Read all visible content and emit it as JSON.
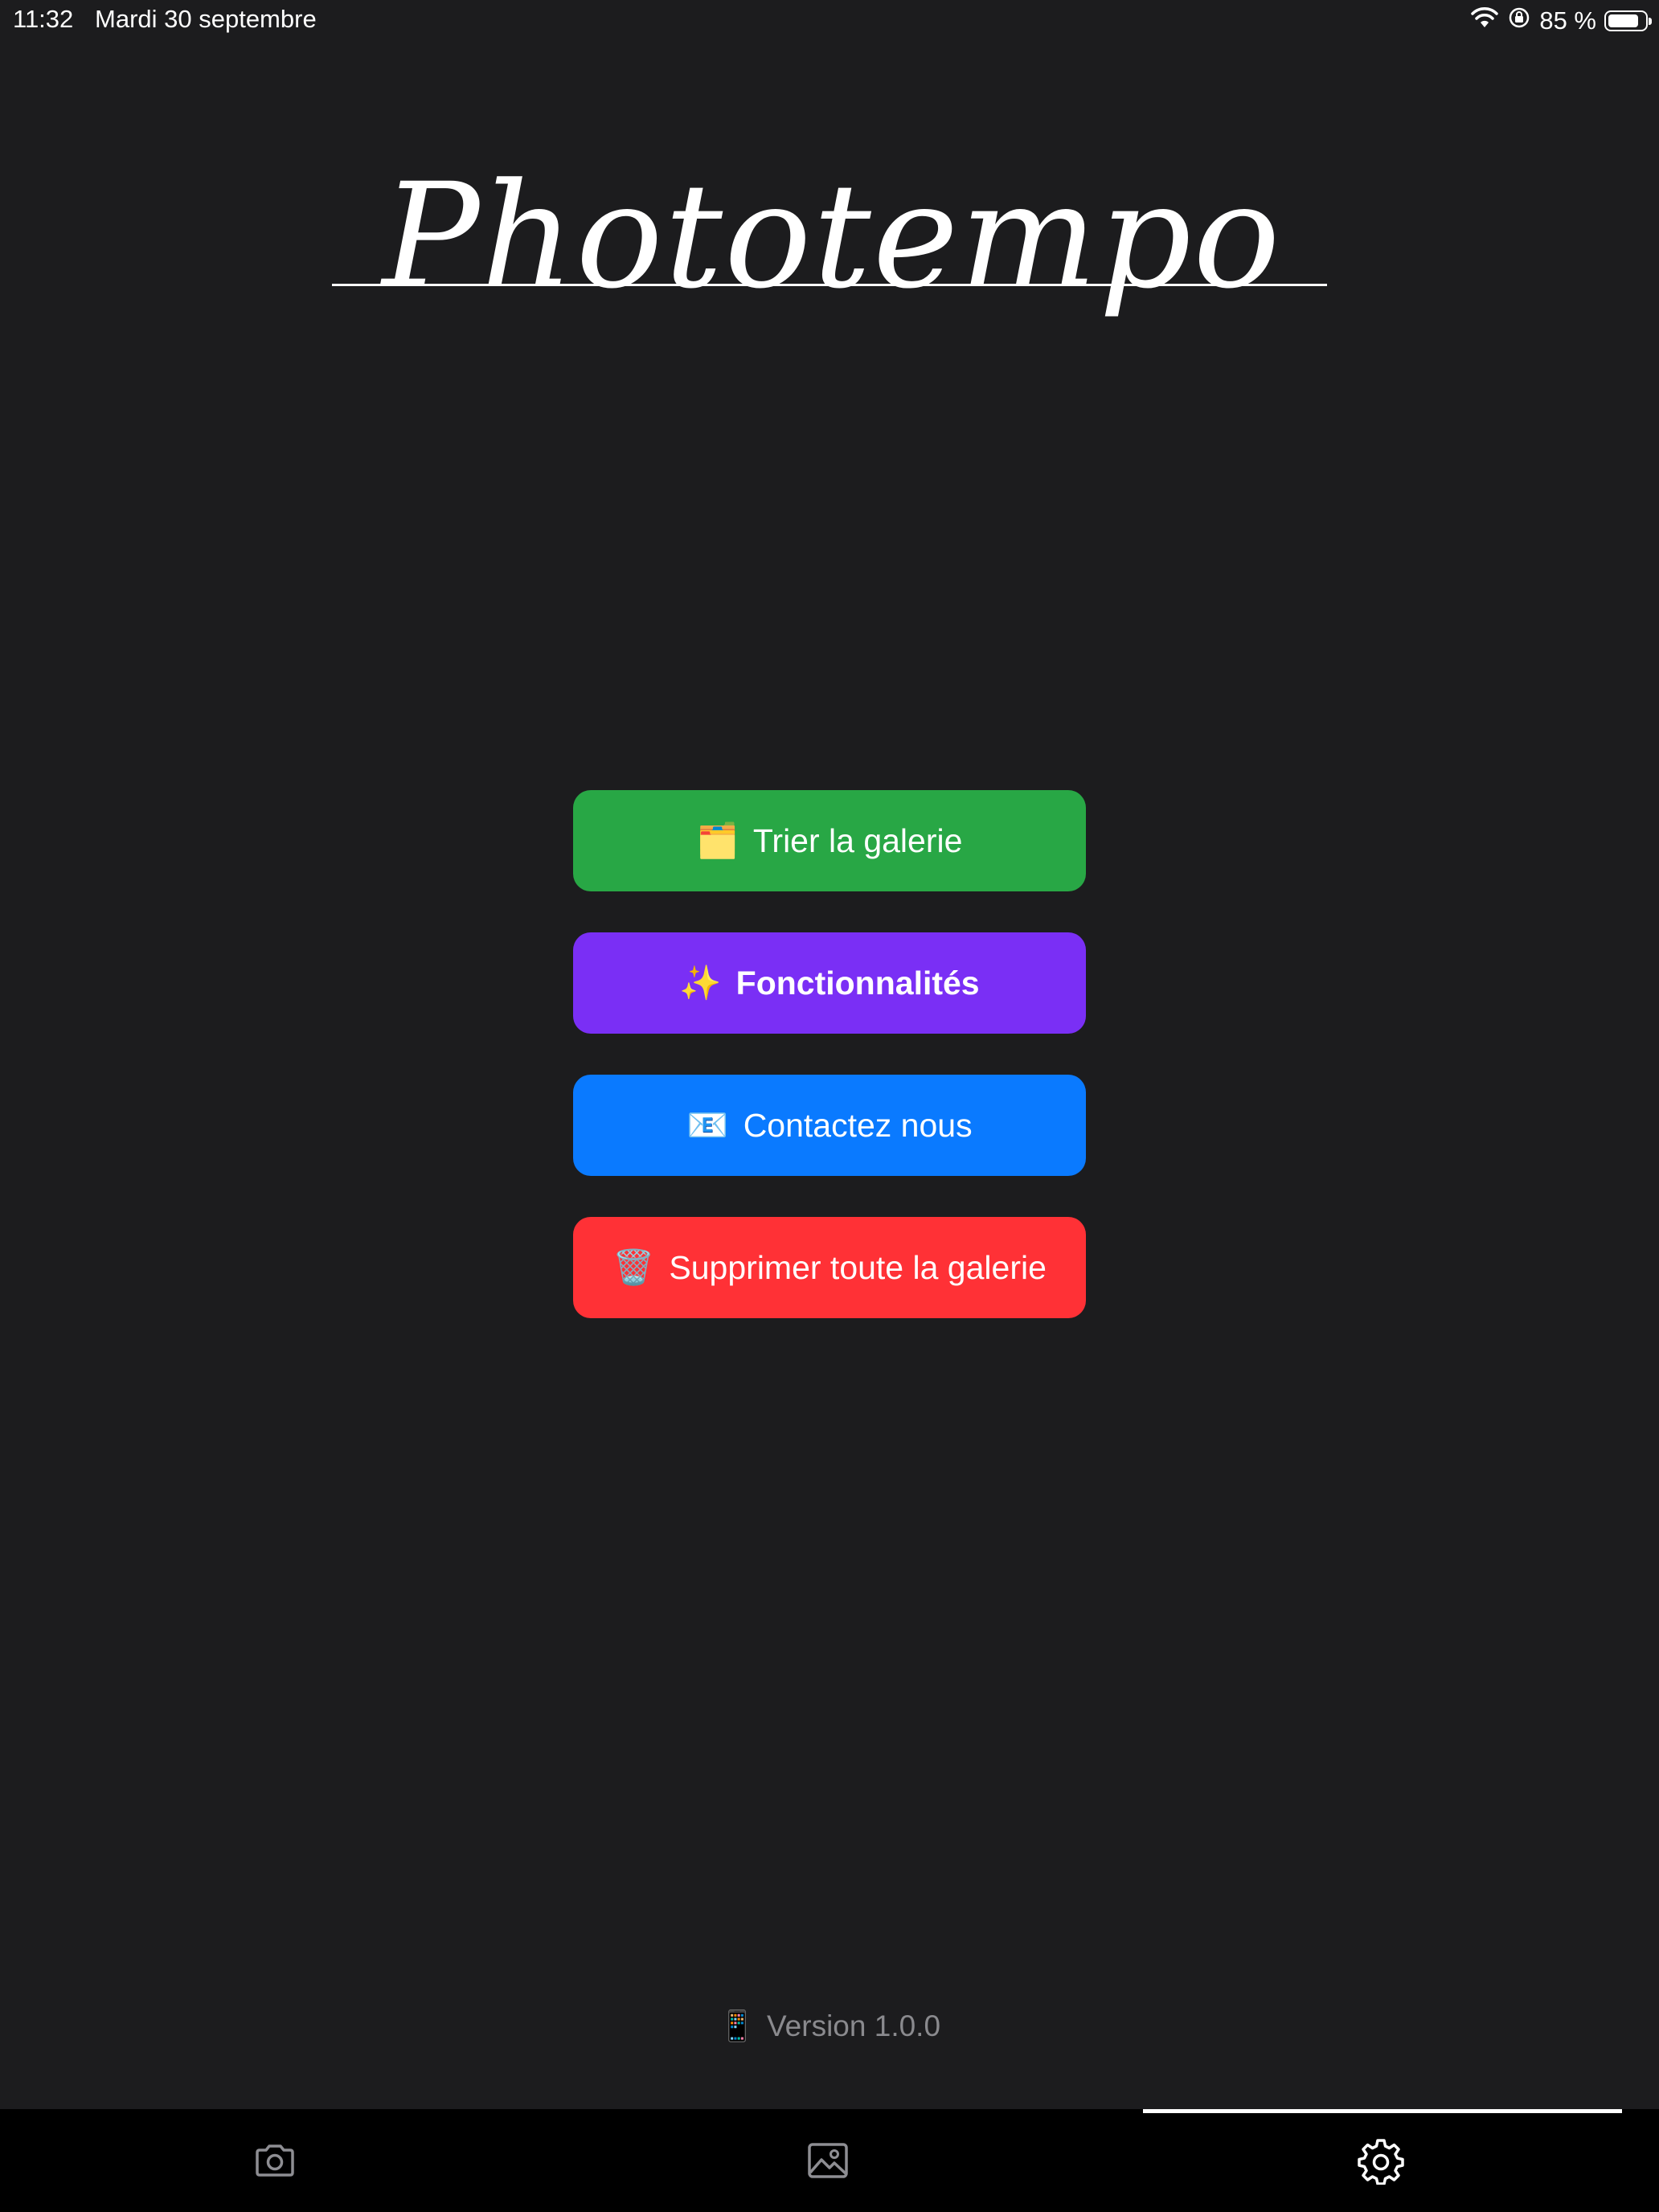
{
  "status_bar": {
    "time": "11:32",
    "date": "Mardi 30 septembre",
    "battery_text": "85 %",
    "battery_level": 0.85
  },
  "logo": {
    "text": "Phototempo"
  },
  "menu": {
    "sort": {
      "emoji": "🗂️",
      "label": "Trier la galerie",
      "color": "#28a745"
    },
    "features": {
      "emoji": "✨",
      "label": "Fonctionnalités",
      "color": "#7a2ff5"
    },
    "contact": {
      "emoji": "📧",
      "label": "Contactez nous",
      "color": "#0a7aff"
    },
    "delete_all": {
      "emoji": "🗑️",
      "label": "Supprimer toute la galerie",
      "color": "#ff3136"
    }
  },
  "version": {
    "emoji": "📱",
    "label": "Version 1.0.0"
  },
  "tabs": [
    {
      "icon": "camera-icon",
      "active": false
    },
    {
      "icon": "gallery-icon",
      "active": false
    },
    {
      "icon": "gear-icon",
      "active": true
    }
  ],
  "colors": {
    "background": "#1c1c1e",
    "tabbar": "#000000",
    "muted_text": "#8a8a8e",
    "inactive_icon": "#8e8e93"
  }
}
